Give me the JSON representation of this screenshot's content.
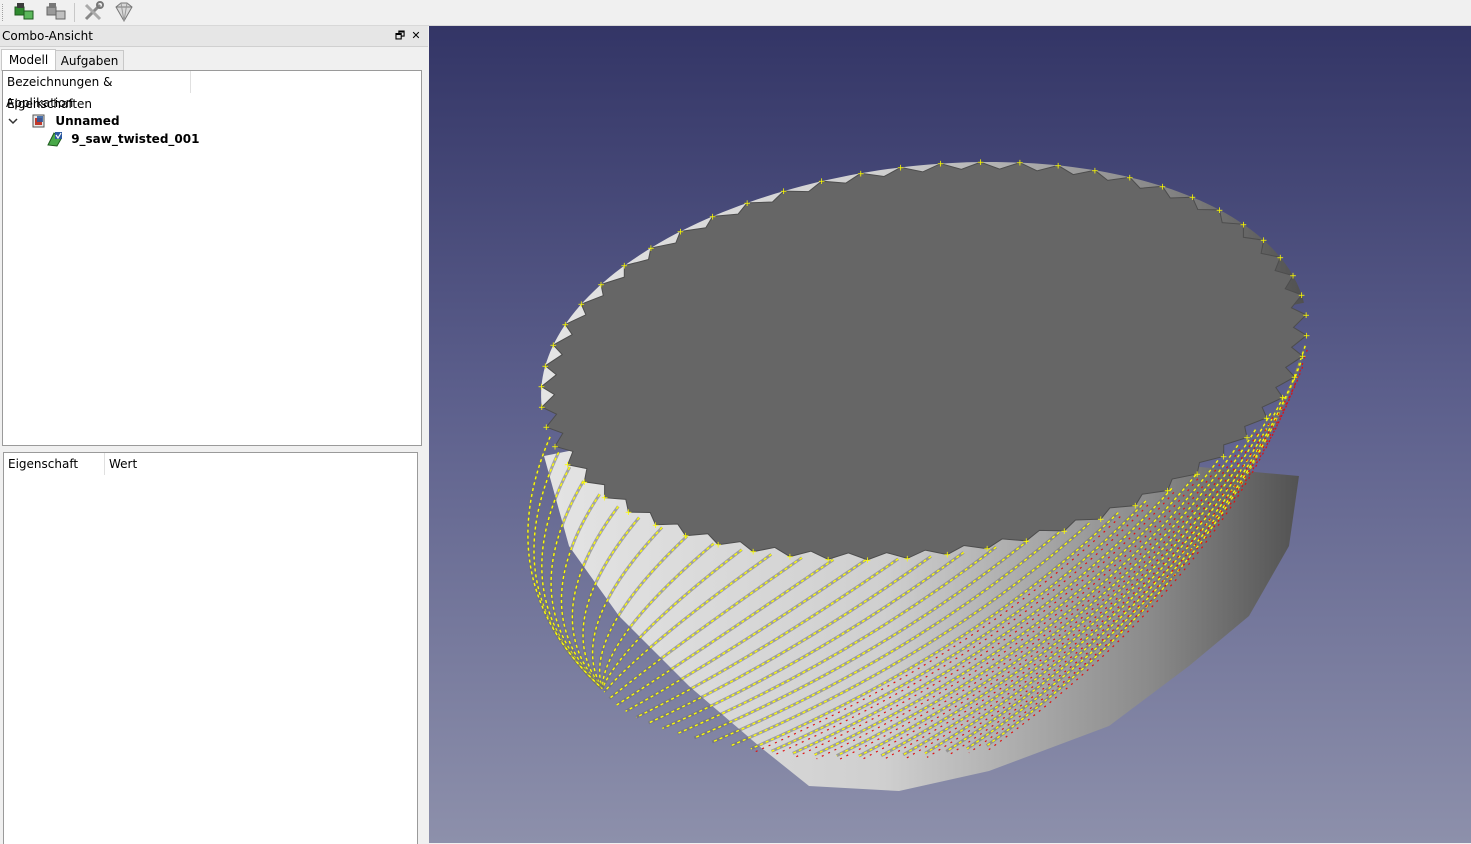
{
  "toolbar": {
    "buttons": [
      {
        "icon": "boolean-import-icon"
      },
      {
        "icon": "boolean-export-icon"
      },
      {
        "icon": "tools-icon"
      },
      {
        "icon": "gem-icon"
      }
    ]
  },
  "combo": {
    "title": "Combo-Ansicht",
    "tabs": [
      {
        "label": "Modell",
        "active": true
      },
      {
        "label": "Aufgaben",
        "active": false
      }
    ],
    "tree": {
      "header": "Bezeichnungen & Eigenschaften",
      "root_label": "Applikation",
      "document": "Unnamed",
      "object": "9_saw_twisted_001"
    },
    "properties": {
      "col_property": "Eigenschaft",
      "col_value": "Wert"
    }
  },
  "viewport": {
    "background_top": "#333566",
    "background_bottom": "#8d90ab",
    "shape_color": "#c8c8c8",
    "top_face_color": "#666666",
    "edge_marker_color": "#ffff00",
    "vertex_marker_color": "#e01010"
  }
}
